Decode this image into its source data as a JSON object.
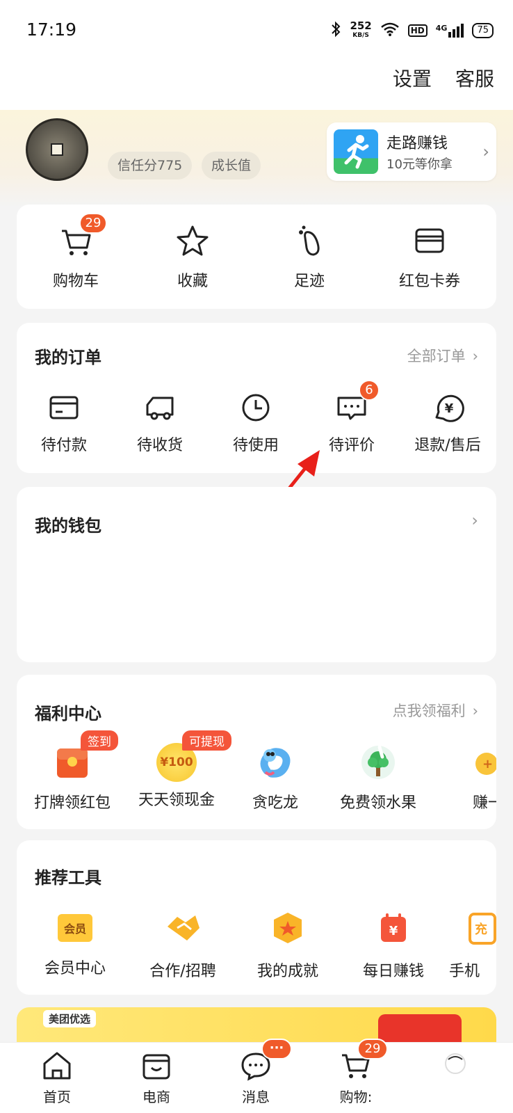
{
  "status": {
    "time": "17:19",
    "speed_value": "252",
    "speed_unit": "KB/S",
    "hd": "HD",
    "network": "4G",
    "battery": "75"
  },
  "header": {
    "settings": "设置",
    "service": "客服"
  },
  "profile": {
    "trust_score": "信任分775",
    "growth": "成长值"
  },
  "walk_card": {
    "title": "走路赚钱",
    "subtitle": "10元等你拿"
  },
  "quick_links": [
    {
      "label": "购物车",
      "badge": "29"
    },
    {
      "label": "收藏"
    },
    {
      "label": "足迹"
    },
    {
      "label": "红包卡券"
    }
  ],
  "orders": {
    "title": "我的订单",
    "all_link": "全部订单",
    "items": [
      {
        "label": "待付款"
      },
      {
        "label": "待收货"
      },
      {
        "label": "待使用"
      },
      {
        "label": "待评价",
        "badge": "6"
      },
      {
        "label": "退款/售后"
      }
    ]
  },
  "wallet": {
    "title": "我的钱包"
  },
  "welfare": {
    "title": "福利中心",
    "link": "点我领福利",
    "items": [
      {
        "label": "打牌领红包",
        "tag": "签到"
      },
      {
        "label": "天天领现金",
        "tag": "可提现",
        "coin": "¥100"
      },
      {
        "label": "贪吃龙"
      },
      {
        "label": "免费领水果"
      },
      {
        "label": "赚一"
      }
    ]
  },
  "tools": {
    "title": "推荐工具",
    "items": [
      {
        "label": "会员中心",
        "icon_text": "会员"
      },
      {
        "label": "合作/招聘"
      },
      {
        "label": "我的成就"
      },
      {
        "label": "每日赚钱",
        "icon_text": "¥"
      },
      {
        "label": "手机",
        "icon_text": "充"
      }
    ]
  },
  "banner": {
    "logo": "美团优选"
  },
  "tabbar": [
    {
      "label": "首页"
    },
    {
      "label": "电商"
    },
    {
      "label": "消息",
      "badge": "···"
    },
    {
      "label": "购物:",
      "badge": "29"
    }
  ]
}
